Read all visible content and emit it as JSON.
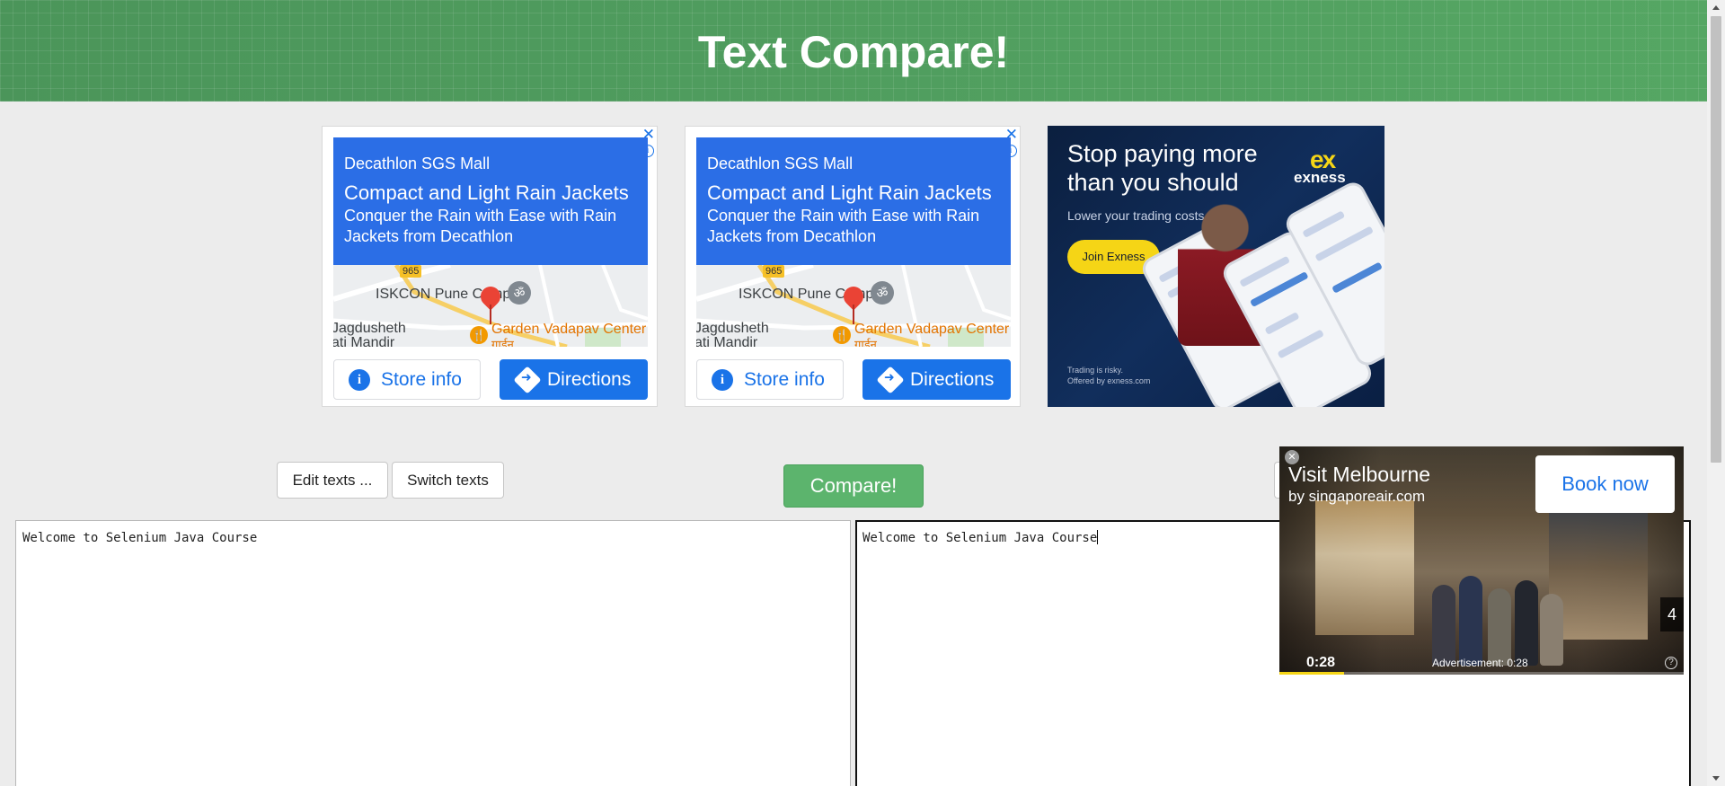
{
  "header": {
    "title": "Text Compare!"
  },
  "ads": {
    "map_ads": [
      {
        "store": "Decathlon SGS Mall",
        "headline": "Compact and Light Rain Jackets",
        "description": "Conquer the Rain with Ease with Rain Jackets from Decathlon",
        "map_labels": {
          "road": "965",
          "poi1": "ISKCON Pune Camp",
          "poi2": "Jagdusheth",
          "poi3": "ati Mandir",
          "poi4": "Garden Vadapav Center",
          "poi4_local": "गार्डन"
        },
        "store_button": "Store info",
        "directions_button": "Directions",
        "close": "✕",
        "info": "i"
      },
      {
        "store": "Decathlon SGS Mall",
        "headline": "Compact and Light Rain Jackets",
        "description": "Conquer the Rain with Ease with Rain Jackets from Decathlon",
        "map_labels": {
          "road": "965",
          "poi1": "ISKCON Pune Camp",
          "poi2": "Jagdusheth",
          "poi3": "ati Mandir",
          "poi4": "Garden Vadapav Center",
          "poi4_local": "गार्डन"
        },
        "store_button": "Store info",
        "directions_button": "Directions",
        "close": "✕",
        "info": "i"
      }
    ],
    "exness": {
      "headline": "Stop paying more than you should",
      "logo_mark": "ex",
      "logo": "exness",
      "subtext": "Lower your trading costs",
      "button": "Join Exness",
      "risk_line1": "Trading is risky.",
      "risk_line2": "Offered by exness.com"
    },
    "video": {
      "title": "Visit Melbourne",
      "by": "by singaporeair.com",
      "button": "Book now",
      "skip_count": "4",
      "time": "0:28",
      "ad_label": "Advertisement: 0:28",
      "help": "?",
      "close": "✕",
      "progress": 0.16
    }
  },
  "toolbar": {
    "edit_texts": "Edit texts ...",
    "switch_texts": "Switch texts",
    "compare": "Compare!"
  },
  "texts": {
    "left": "Welcome to Selenium Java Course",
    "right": "Welcome to Selenium Java Course"
  },
  "colors": {
    "header_green": "#4f9d5e",
    "compare_green": "#5cb46d",
    "ad_blue": "#1a73e8",
    "exness_yellow": "#f5d516"
  }
}
